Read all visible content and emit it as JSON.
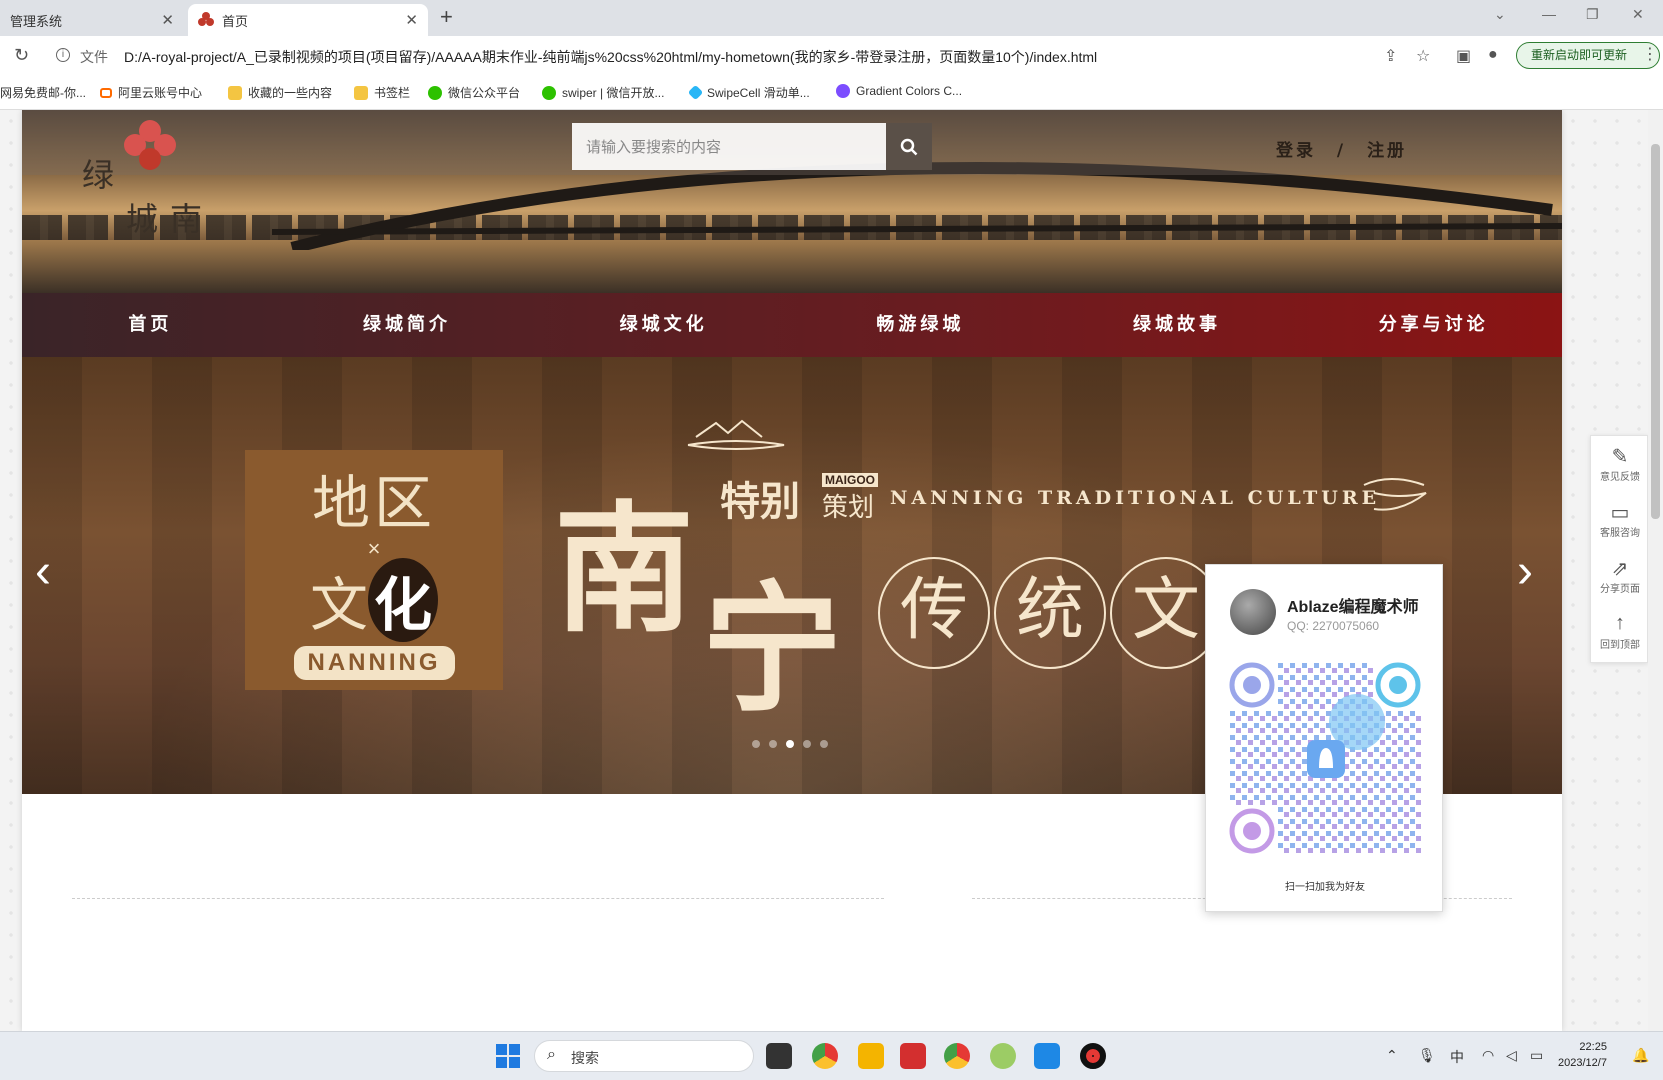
{
  "browser": {
    "tabs": [
      {
        "title": "管理系统",
        "active": false
      },
      {
        "title": "首页",
        "active": true
      }
    ],
    "file_label": "文件",
    "url": "D:/A-royal-project/A_已录制视频的项目(项目留存)/AAAAA期末作业-纯前端js%20css%20html/my-hometown(我的家乡-带登录注册，页面数量10个)/index.html",
    "update_button": "重新启动即可更新",
    "bookmarks": [
      "网易免费邮-你...",
      "阿里云账号中心",
      "收藏的一些内容",
      "书签栏",
      "微信公众平台",
      "swiper | 微信开放...",
      "SwipeCell 滑动单...",
      "Gradient Colors C..."
    ]
  },
  "site": {
    "logo_chars": [
      "绿",
      "城",
      "南"
    ],
    "search_placeholder": "请输入要搜索的内容",
    "login": "登录",
    "separator": "/",
    "register": "注册",
    "nav": [
      "首页",
      "绿城简介",
      "绿城文化",
      "畅游绿城",
      "绿城故事",
      "分享与讨论"
    ],
    "slider": {
      "box_line1": "地区",
      "box_x": "×",
      "box_line2_a": "文",
      "box_line2_b": "化",
      "box_pill": "NANNING",
      "big_1": "南",
      "big_2": "宁",
      "special": "特别",
      "maigoo": "MAIGOO",
      "cehua": "策划",
      "en_title": "NANNING TRADITIONAL CULTURE",
      "circle_chars": [
        "传",
        "统",
        "文"
      ],
      "dot_count": 5,
      "active_dot": 3
    }
  },
  "qq_card": {
    "name": "Ablaze编程魔术师",
    "qq": "QQ: 2270075060",
    "caption": "扫一扫加我为好友"
  },
  "side_toolbar": [
    {
      "icon": "pencil-icon",
      "label": "意见反馈"
    },
    {
      "icon": "monitor-icon",
      "label": "客服咨询"
    },
    {
      "icon": "share-icon",
      "label": "分享页面"
    },
    {
      "icon": "arrow-up-icon",
      "label": "回到顶部"
    }
  ],
  "taskbar": {
    "search_text": "搜索",
    "ime": "中",
    "time": "22:25",
    "date": "2023/12/7"
  }
}
